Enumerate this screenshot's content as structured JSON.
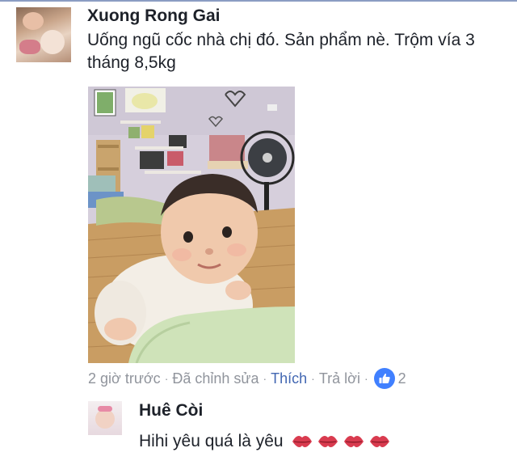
{
  "comment": {
    "author": "Xuong Rong Gai",
    "text": "Uống ngũ cốc nhà chị đó. Sản phẩm nè. Trộm vía 3 tháng 8,5kg",
    "photo_icon": "baby-photo",
    "meta": {
      "time": "2 giờ trước",
      "edited": "Đã chỉnh sửa",
      "like": "Thích",
      "reply": "Trả lời",
      "separator": "·",
      "reaction_icon": "thumbs-up-icon",
      "reaction_count": "2"
    }
  },
  "reply": {
    "author": "Huê Còi",
    "text": "Hihi yêu quá là yêu",
    "emoji_icon": "kiss-mark-icon",
    "emoji_count": 4
  },
  "colors": {
    "link_blue": "#4267b2",
    "meta_gray": "#90949c",
    "like_badge": "#4080ff",
    "text": "#1d2129"
  }
}
